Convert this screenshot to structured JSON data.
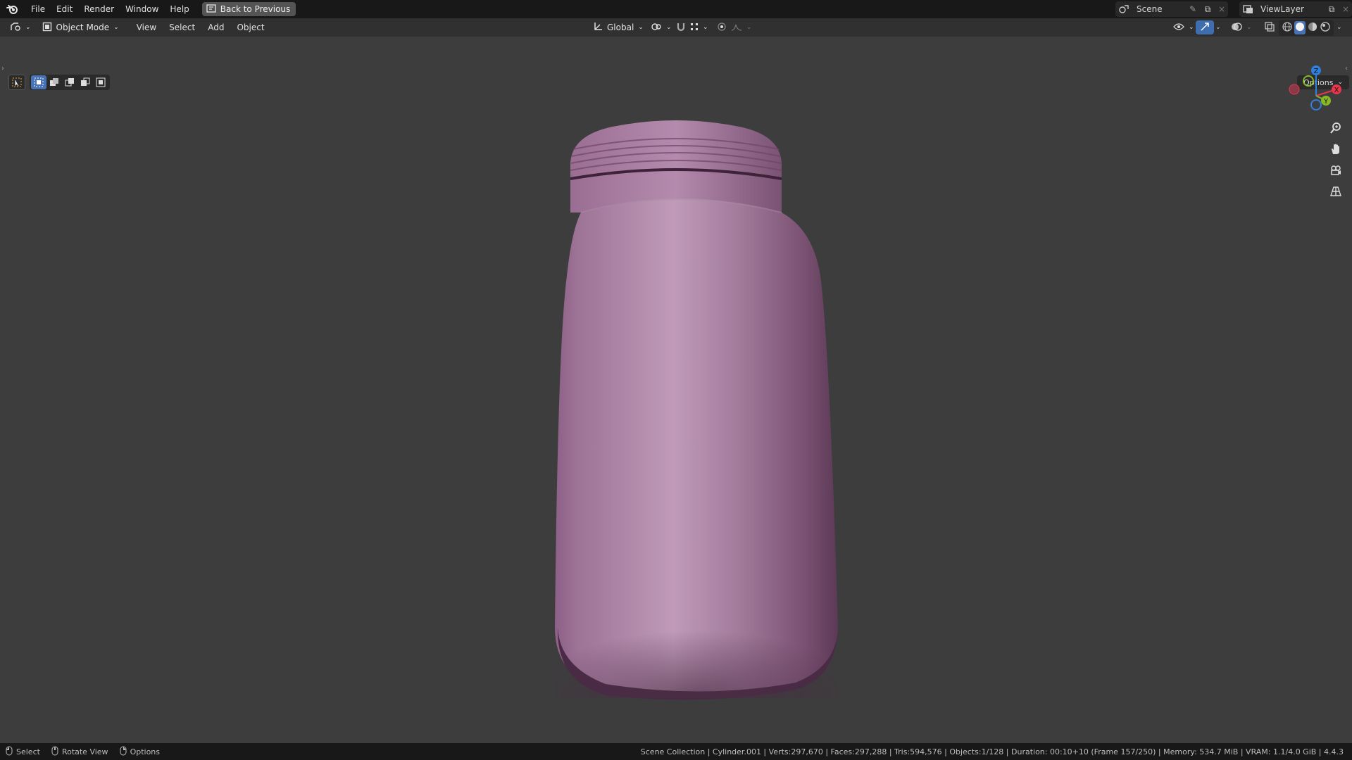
{
  "topbar": {
    "menus": [
      "File",
      "Edit",
      "Render",
      "Window",
      "Help"
    ],
    "back_label": "Back to Previous",
    "scene_label": "Scene",
    "viewlayer_label": "ViewLayer"
  },
  "header": {
    "mode_label": "Object Mode",
    "menus": [
      "View",
      "Select",
      "Add",
      "Object"
    ],
    "orientation_label": "Global",
    "options_label": "Options"
  },
  "statusbar": {
    "hints": [
      {
        "label": "Select",
        "icon": "mouse-left-icon"
      },
      {
        "label": "Rotate View",
        "icon": "mouse-middle-icon"
      },
      {
        "label": "Options",
        "icon": "mouse-right-icon"
      }
    ],
    "info": "Scene Collection | Cylinder.001 | Verts:297,670 | Faces:297,288 | Tris:594,576 | Objects:1/128 | Duration: 00:10+10 (Frame 157/250) | Memory: 534.7 MiB | VRAM: 1.1/4.0 GiB | 4.4.3"
  },
  "gizmo": {
    "axes": {
      "x": "X",
      "y": "Y",
      "z": "Z"
    },
    "colors": {
      "x": "#e8374b",
      "y": "#89b826",
      "z": "#2f7fdd"
    }
  },
  "object": {
    "color": "#a57a9d"
  }
}
